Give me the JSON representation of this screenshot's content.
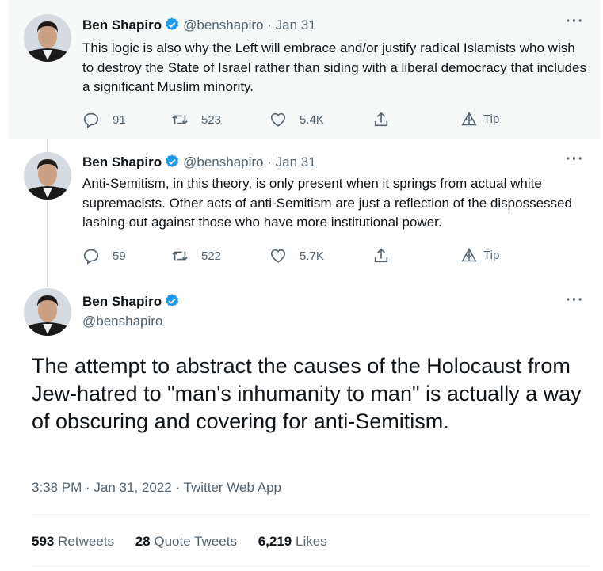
{
  "colors": {
    "accent": "#1d9bf0",
    "muted": "#536471",
    "text": "#0f1419",
    "divider": "#eff3f4"
  },
  "tweets": [
    {
      "name": "Ben Shapiro",
      "handle": "@benshapiro",
      "sep": "·",
      "date": "Jan 31",
      "text": "This logic is also why the Left will embrace and/or justify radical Islamists who wish to destroy the State of Israel rather than siding with a liberal democracy that includes a significant Muslim minority.",
      "replies": "91",
      "retweets": "523",
      "likes": "5.4K",
      "tip": "Tip"
    },
    {
      "name": "Ben Shapiro",
      "handle": "@benshapiro",
      "sep": "·",
      "date": "Jan 31",
      "text": "Anti-Semitism, in this theory, is only present when it springs from actual white supremacists. Other acts of anti-Semitism are just a reflection of the dispossessed lashing out against those who have more institutional power.",
      "replies": "59",
      "retweets": "522",
      "likes": "5.7K",
      "tip": "Tip"
    }
  ],
  "main": {
    "name": "Ben Shapiro",
    "handle": "@benshapiro",
    "text": "The attempt to abstract the causes of the Holocaust from Jew-hatred to \"man's inhumanity to man\" is actually a way of obscuring and covering for anti-Semitism.",
    "time": "3:38 PM · Jan 31, 2022 · Twitter Web App",
    "retweets_count": "593",
    "retweets_label": "Retweets",
    "quotes_count": "28",
    "quotes_label": "Quote Tweets",
    "likes_count": "6,219",
    "likes_label": "Likes"
  },
  "icons": [
    "reply-icon",
    "retweet-icon",
    "like-icon",
    "share-icon",
    "tip-icon",
    "verified-badge-icon",
    "more-icon"
  ]
}
